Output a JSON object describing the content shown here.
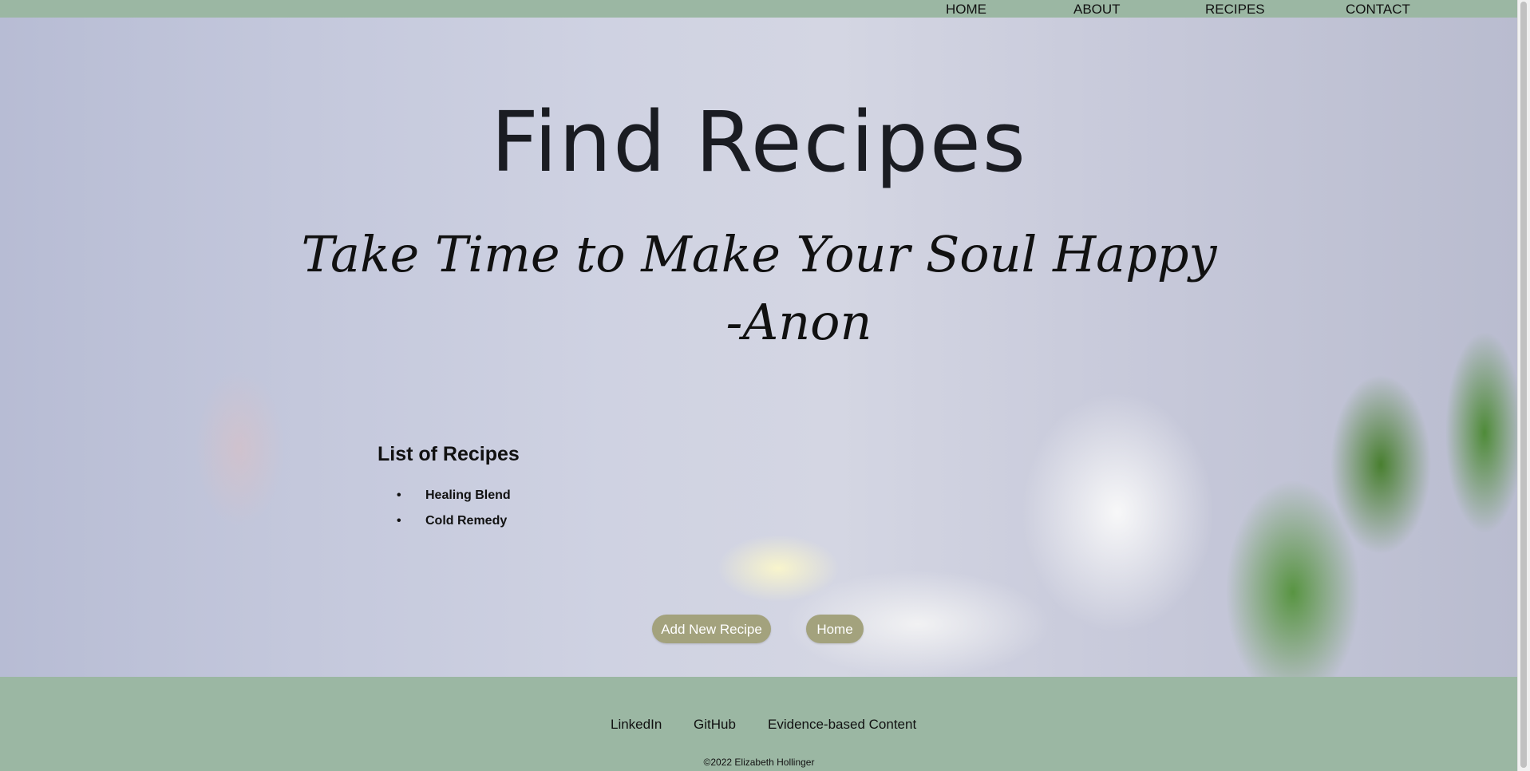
{
  "nav": {
    "items": [
      {
        "label": "HOME"
      },
      {
        "label": "ABOUT"
      },
      {
        "label": "RECIPES"
      },
      {
        "label": "CONTACT"
      }
    ]
  },
  "hero": {
    "title": "Find Recipes",
    "quote_line1": "Take Time to Make Your Soul Happy",
    "quote_line2": "-Anon"
  },
  "recipes": {
    "heading": "List of Recipes",
    "items": [
      {
        "label": "Healing Blend"
      },
      {
        "label": "Cold Remedy"
      }
    ]
  },
  "buttons": {
    "add_label": "Add New Recipe",
    "home_label": "Home",
    "color": "#a3a27d"
  },
  "footer": {
    "links": [
      {
        "label": "LinkedIn"
      },
      {
        "label": "GitHub"
      },
      {
        "label": "Evidence-based Content"
      }
    ],
    "copyright": "©2022 Elizabeth Hollinger"
  },
  "colors": {
    "nav_footer_bg": "#9bb7a3"
  }
}
